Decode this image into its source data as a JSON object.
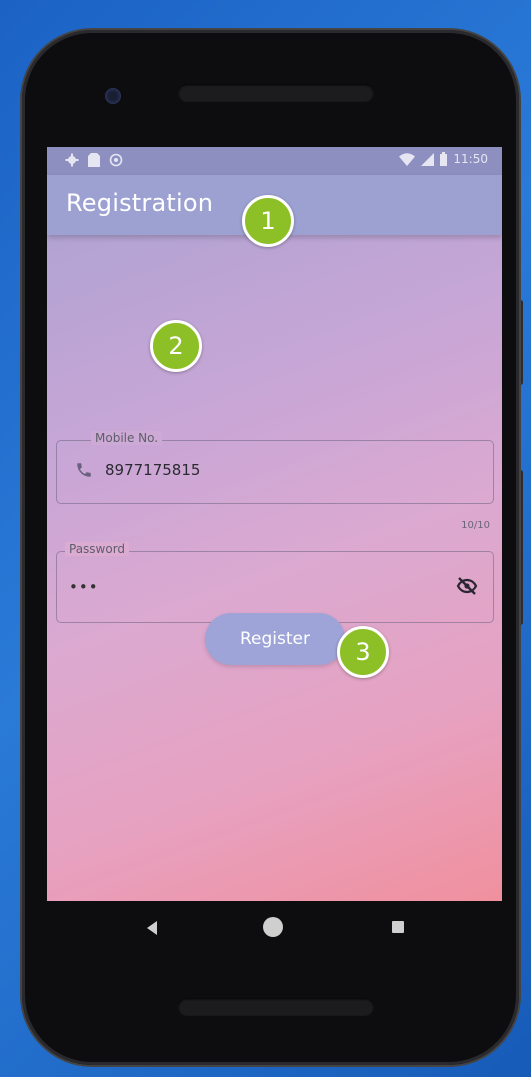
{
  "status_bar": {
    "time": "11:50"
  },
  "app_bar": {
    "title": "Registration"
  },
  "mobile": {
    "label": "Mobile No.",
    "value": "8977175815",
    "counter": "10/10"
  },
  "password": {
    "label": "Password",
    "value": "•••"
  },
  "register": {
    "label": "Register"
  },
  "annotations": [
    "1",
    "2",
    "3"
  ],
  "colors": {
    "badge": "#8dbf26",
    "app_bar": "#9ca1d2",
    "button": "#9ea4d7"
  },
  "icons": [
    "settings-icon",
    "sim-icon",
    "sync-icon",
    "wifi-icon",
    "signal-icon",
    "battery-icon",
    "phone-icon",
    "eye-off-icon",
    "back-icon",
    "home-icon",
    "recents-icon"
  ]
}
